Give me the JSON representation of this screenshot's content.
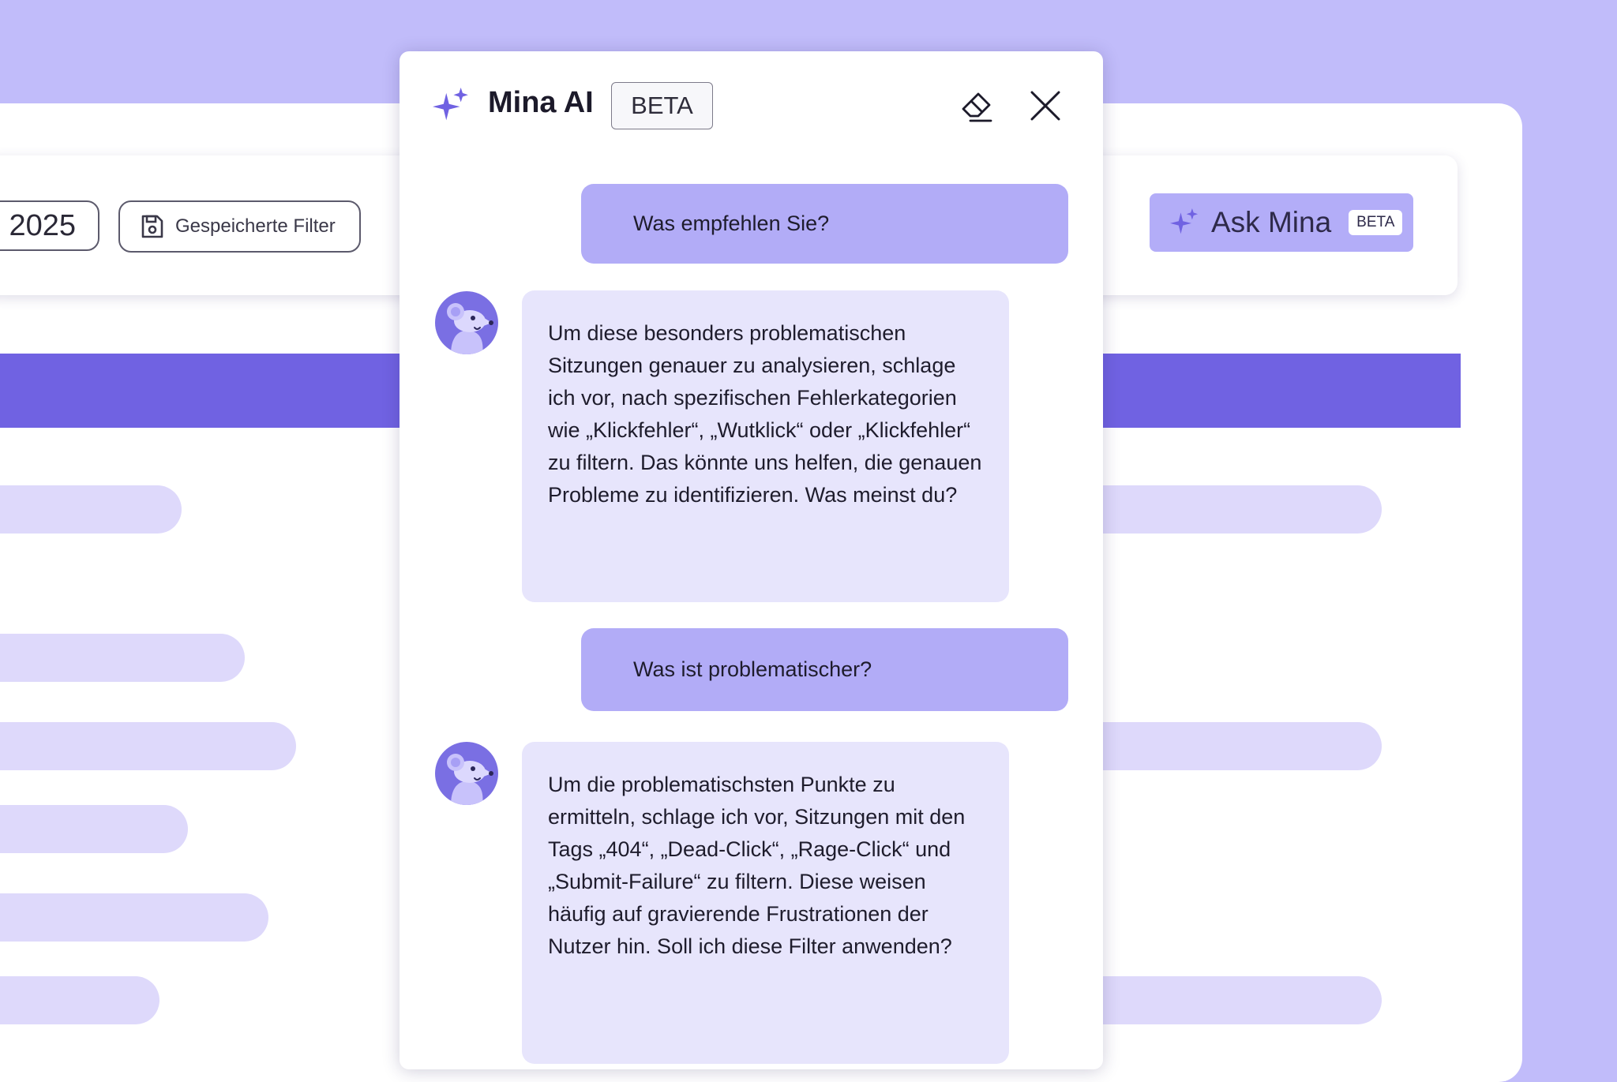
{
  "background": {
    "date_value": "2025",
    "saved_filter_label": "Gespeicherte Filter",
    "ask_mina": {
      "label": "Ask Mina",
      "badge": "BETA"
    }
  },
  "chat": {
    "title": "Mina AI",
    "badge": "BETA",
    "messages": [
      {
        "role": "user",
        "text": "Was empfehlen Sie?"
      },
      {
        "role": "assistant",
        "text": "Um diese besonders problematischen Sitzungen genauer zu analysieren, schlage ich vor, nach spezifischen Fehlerkategorien wie „Klickfehler“, „Wutklick“ oder „Klickfehler“ zu filtern. Das könnte uns helfen, die genauen Probleme zu identifizieren. Was meinst du?"
      },
      {
        "role": "user",
        "text": "Was ist problematischer?"
      },
      {
        "role": "assistant",
        "text": "Um die problematischsten Punkte zu ermitteln, schlage ich vor, Sitzungen mit den Tags „404“, „Dead-Click“, „Rage-Click“ und „Submit-Failure“ zu filtern. Diese weisen häufig auf gravierende Frustrationen der Nutzer hin. Soll ich diese Filter anwenden?"
      }
    ]
  },
  "colors": {
    "page_background": "#c1bcfa",
    "accent": "#7062e2",
    "user_bubble": "#b2acf7",
    "assistant_bubble": "#e7e5fc",
    "placeholder_bar": "#ded9fb"
  },
  "icons": {
    "header": "sparkle-icon",
    "clear": "eraser-icon",
    "close": "close-icon",
    "saved_filter": "save-icon",
    "assistant_avatar": "mouse-mascot-icon"
  }
}
